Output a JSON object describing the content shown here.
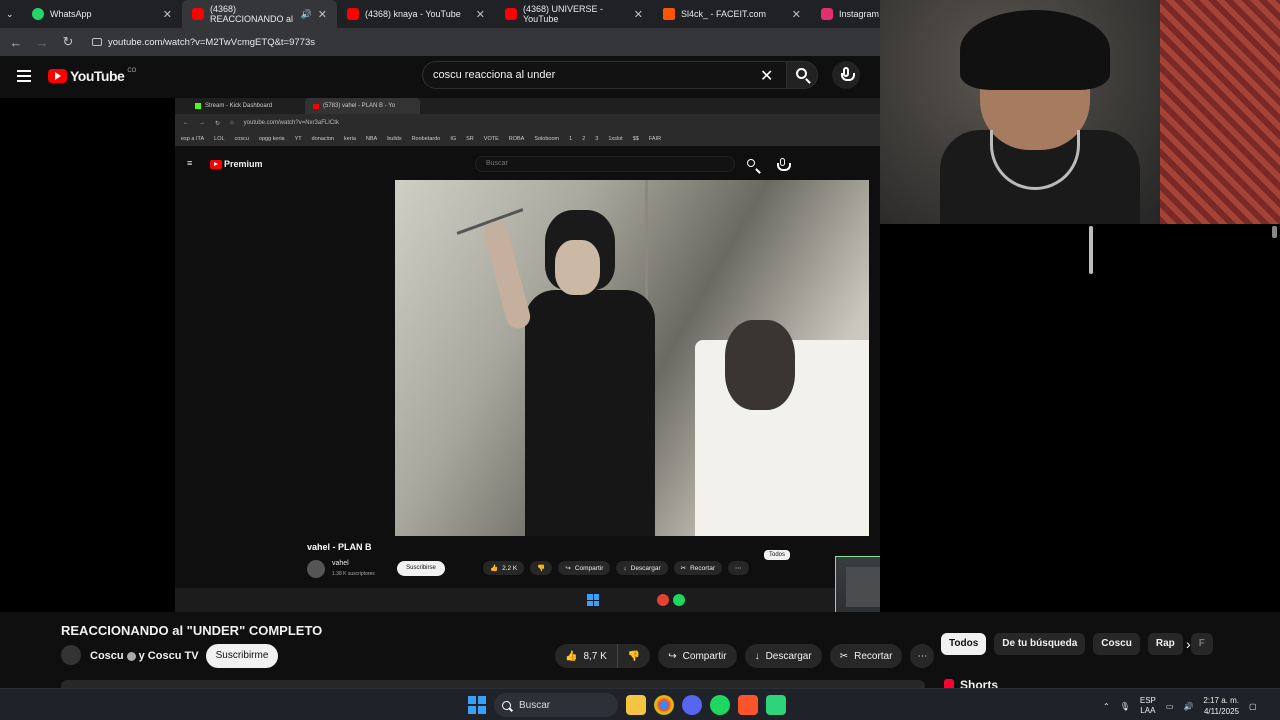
{
  "browser": {
    "tabs": [
      {
        "label": "WhatsApp",
        "color": "#25d366"
      },
      {
        "label": "(4368) REACCIONANDO al",
        "color": "#ff0000",
        "active": true
      },
      {
        "label": "(4368) knaya - YouTube",
        "color": "#ff0000"
      },
      {
        "label": "(4368) UNIVERSE - YouTube",
        "color": "#ff0000"
      },
      {
        "label": "Sl4ck_ - FACEIT.com",
        "color": "#ff5500"
      },
      {
        "label": "Instagram",
        "color": "#e1306c"
      }
    ],
    "url": "youtube.com/watch?v=M2TwVcmgETQ&t=9773s"
  },
  "youtube": {
    "logo_text": "YouTube",
    "country": "CO",
    "search_value": "coscu reacciona al under"
  },
  "inner_screen": {
    "tabs": [
      "Stream - Kick Dashboard",
      "(5783) vahel - PLAN B - Yo"
    ],
    "url": "youtube.com/watch?v=Nxr3aFLICtk",
    "bookmarks": [
      "esp a ITA",
      "LOL",
      "coscu",
      "opgg keria",
      "YT",
      "donacion",
      "keria",
      "NBA",
      "builds",
      "Roobetardo",
      "IG",
      "SR",
      "VOTE",
      "ROBA",
      "Soloboom",
      "1",
      "2",
      "3",
      "1xslot",
      "$$",
      "FAIR"
    ],
    "logo_text": "Premium",
    "search_placeholder": "Buscar",
    "video_title": "vahel - PLAN B",
    "channel": "vahel",
    "subs": "1.38 K suscriptores",
    "subscribe": "Suscribirse",
    "likes": "2.2 K",
    "share": "Compartir",
    "download": "Descargar",
    "clip": "Recortar",
    "chip_all": "Todos"
  },
  "video": {
    "title": "REACCIONANDO al \"UNDER\" COMPLETO",
    "channel": "Coscu",
    "channel_suffix": "y Coscu TV",
    "subscribe": "Suscribirme",
    "likes": "8,7 K",
    "share": "Compartir",
    "download": "Descargar",
    "clip": "Recortar"
  },
  "chips": [
    "Todos",
    "De tu búsqueda",
    "Coscu",
    "Rap",
    "F"
  ],
  "shorts_label": "Shorts",
  "taskbar": {
    "search": "Buscar",
    "lang_top": "ESP",
    "lang_bottom": "LAA",
    "time": "2:17 a. m.",
    "date": "4/11/2025"
  }
}
